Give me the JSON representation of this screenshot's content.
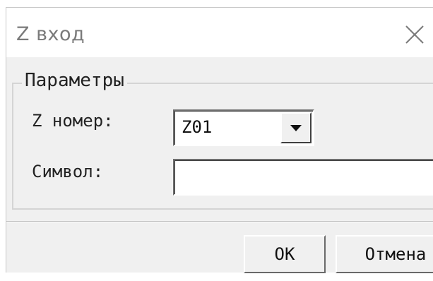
{
  "window": {
    "title": "Z вход"
  },
  "group": {
    "legend": "Параметры",
    "z_number_label": "Z номер:",
    "z_number_value": "Z01",
    "symbol_label": "Символ:",
    "symbol_value": ""
  },
  "buttons": {
    "ok_label": "OK",
    "cancel_label": "Отмена"
  },
  "icons": {
    "close": "close-icon",
    "dropdown": "chevron-down-icon"
  }
}
